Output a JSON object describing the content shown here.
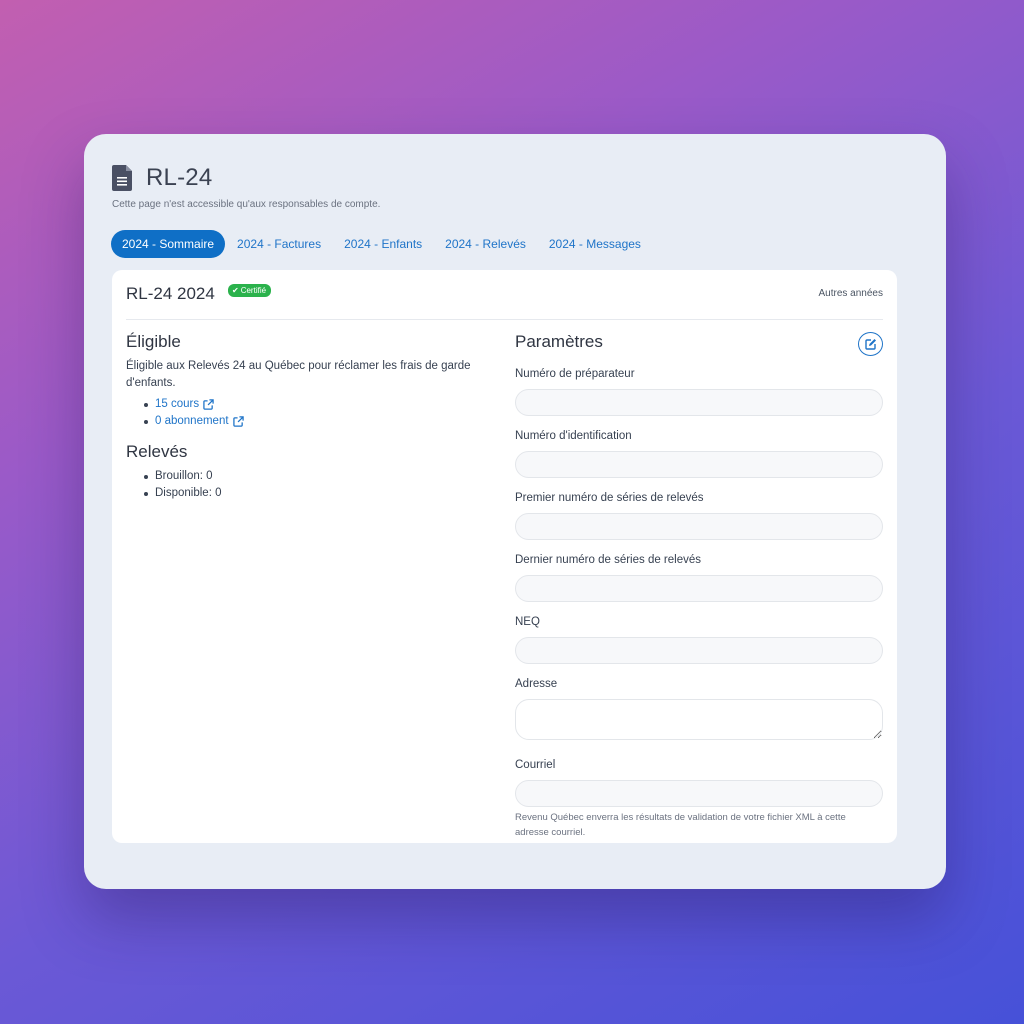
{
  "header": {
    "title": "RL-24",
    "subtitle": "Cette page n'est accessible qu'aux responsables de compte.",
    "icon": "document-icon"
  },
  "tabs": [
    {
      "label": "2024 - Sommaire",
      "active": true
    },
    {
      "label": "2024 - Factures",
      "active": false
    },
    {
      "label": "2024 - Enfants",
      "active": false
    },
    {
      "label": "2024 - Relevés",
      "active": false
    },
    {
      "label": "2024 - Messages",
      "active": false
    }
  ],
  "card": {
    "title": "RL-24 2024",
    "badge": "Certifié",
    "other_years": "Autres années"
  },
  "eligible": {
    "title": "Éligible",
    "text": "Éligible aux Relevés 24 au Québec pour réclamer les frais de garde d'enfants.",
    "links": [
      "15 cours",
      "0 abonnement"
    ]
  },
  "releves": {
    "title": "Relevés",
    "items": [
      "Brouillon: 0",
      "Disponible: 0"
    ]
  },
  "parametres": {
    "title": "Paramètres",
    "fields": [
      {
        "label": "Numéro de préparateur",
        "value": ""
      },
      {
        "label": "Numéro d'identification",
        "value": ""
      },
      {
        "label": "Premier numéro de séries de relevés",
        "value": ""
      },
      {
        "label": "Dernier numéro de séries de relevés",
        "value": ""
      },
      {
        "label": "NEQ",
        "value": ""
      },
      {
        "label": "Adresse",
        "value": ""
      },
      {
        "label": "Courriel",
        "value": ""
      }
    ],
    "help": "Revenu Québec enverra les résultats de validation de votre fichier XML à cette adresse courriel."
  },
  "colors": {
    "accent": "#0f6fc6",
    "badge": "#2bb24c",
    "window_bg": "#e8edf5"
  }
}
